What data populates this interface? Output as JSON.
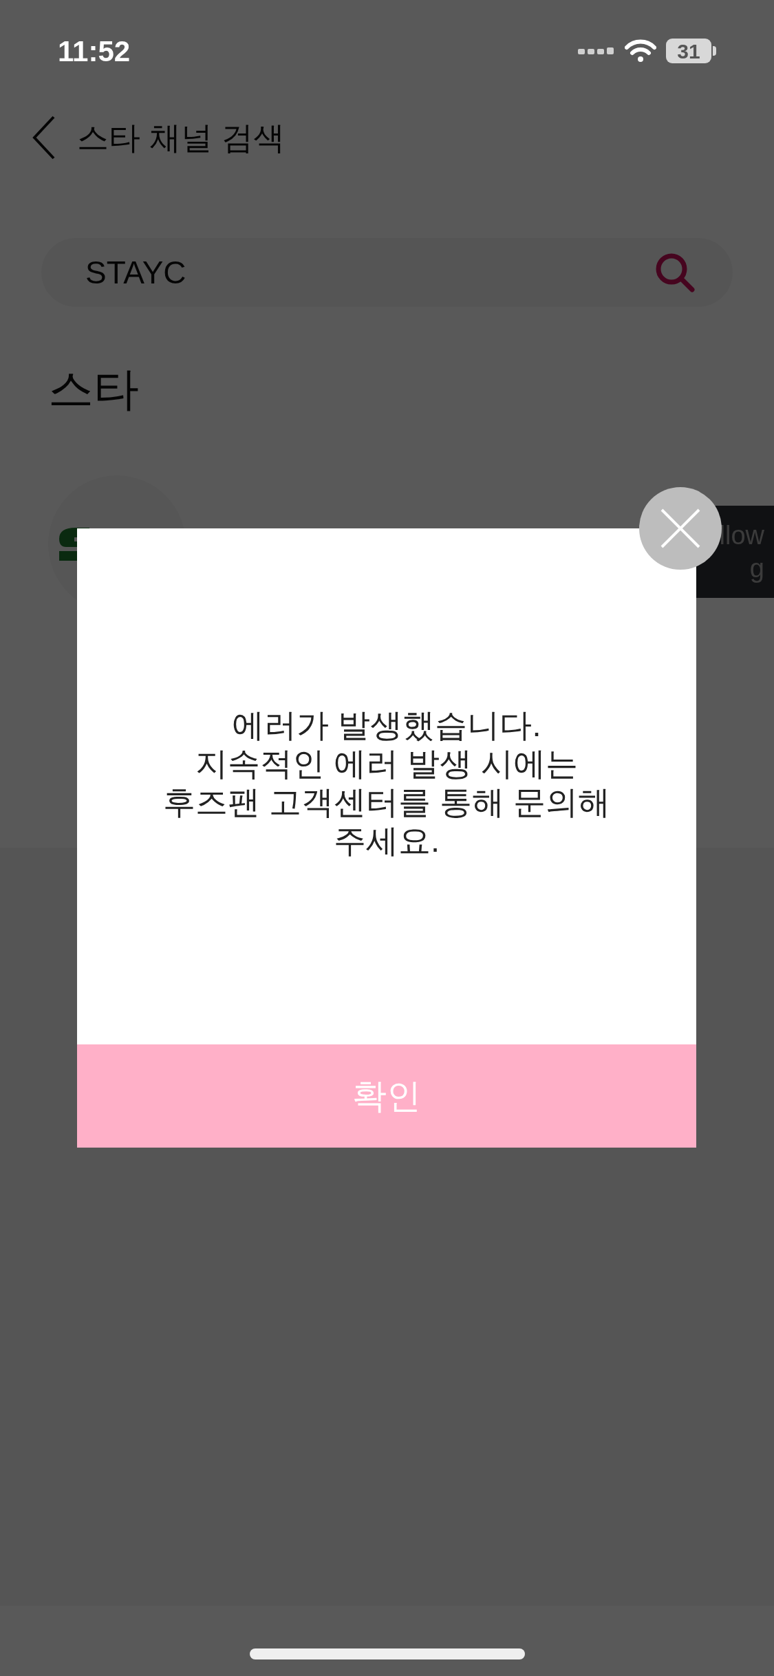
{
  "status_bar": {
    "time": "11:52",
    "battery": "31"
  },
  "header": {
    "title": "스타 채널 검색"
  },
  "search": {
    "value": "STAYC"
  },
  "section": {
    "title": "스타"
  },
  "results": [
    {
      "button_lines": [
        "llow",
        "g"
      ]
    }
  ],
  "dialog": {
    "message_lines": [
      "에러가 발생했습니다.",
      "지속적인 에러 발생 시에는",
      "후즈팬 고객센터를 통해 문의해",
      "주세요."
    ],
    "confirm": "확인"
  }
}
